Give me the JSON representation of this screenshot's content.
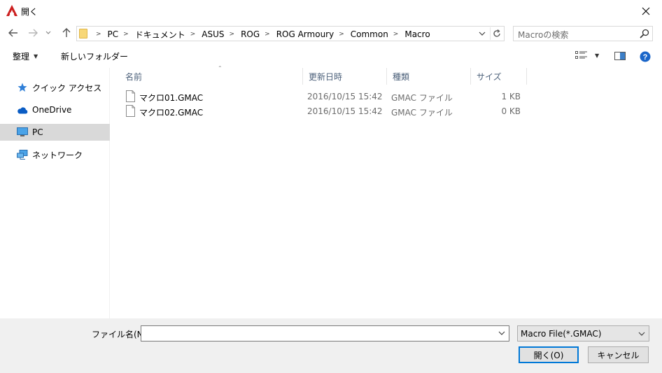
{
  "window": {
    "title": "開く",
    "colors": {
      "accent": "#0078d7",
      "app_icon": "#cc1f1f"
    }
  },
  "nav": {
    "back_icon": "back-arrow-icon",
    "forward_icon": "forward-arrow-icon",
    "up_icon": "up-arrow-icon",
    "breadcrumbs": [
      "PC",
      "ドキュメント",
      "ASUS",
      "ROG",
      "ROG Armoury",
      "Common",
      "Macro"
    ],
    "search_placeholder": "Macroの検索"
  },
  "toolbar": {
    "organize_label": "整理",
    "new_folder_label": "新しいフォルダー"
  },
  "sidebar": {
    "items": [
      {
        "label": "クイック アクセス",
        "icon": "star-icon"
      },
      {
        "label": "OneDrive",
        "icon": "cloud-icon"
      },
      {
        "label": "PC",
        "icon": "computer-icon",
        "selected": true
      },
      {
        "label": "ネットワーク",
        "icon": "network-icon"
      }
    ]
  },
  "files": {
    "columns": {
      "name": "名前",
      "date": "更新日時",
      "type": "種類",
      "size": "サイズ"
    },
    "rows": [
      {
        "name": "マクロ01.GMAC",
        "date": "2016/10/15 15:42",
        "type": "GMAC ファイル",
        "size": "1 KB"
      },
      {
        "name": "マクロ02.GMAC",
        "date": "2016/10/15 15:42",
        "type": "GMAC ファイル",
        "size": "0 KB"
      }
    ]
  },
  "bottom": {
    "filename_label": "ファイル名(N):",
    "filename_value": "",
    "filter_value": "Macro File(*.GMAC)",
    "open_label": "開く(O)",
    "cancel_label": "キャンセル"
  }
}
